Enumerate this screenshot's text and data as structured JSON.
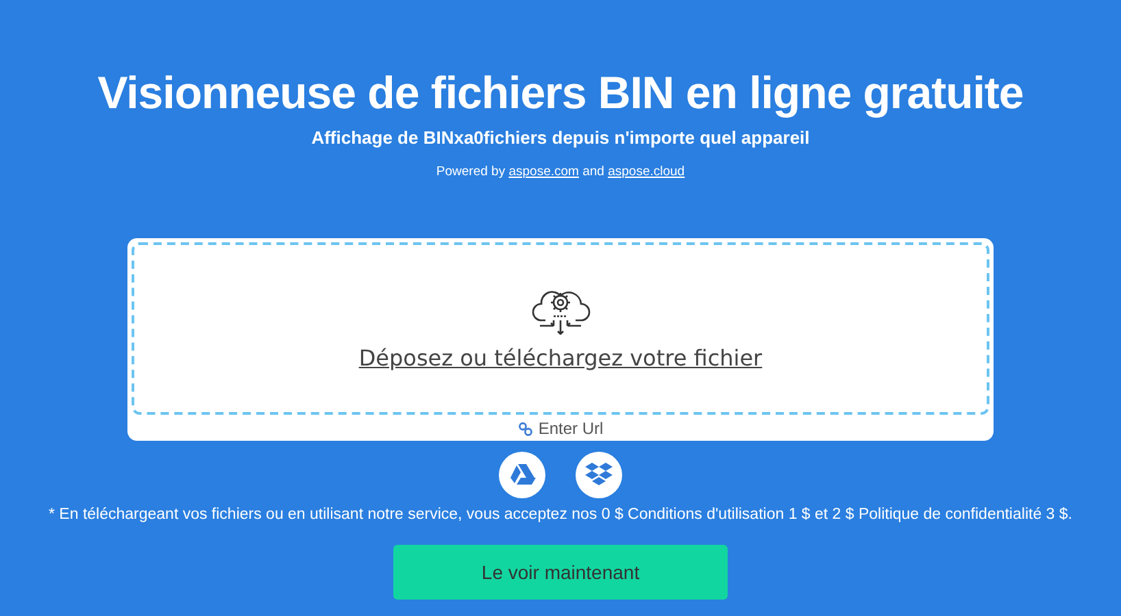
{
  "title": "Visionneuse de fichiers BIN en ligne gratuite",
  "subtitle": "Affichage de BINxa0fichiers depuis n'importe quel appareil",
  "powered": {
    "prefix": "Powered by",
    "links": [
      "aspose.com",
      "aspose.cloud"
    ],
    "joiner": "and"
  },
  "upload": {
    "label": "Déposez ou téléchargez votre fichier",
    "url_label": "Enter Url"
  },
  "cloud_sources": [
    {
      "kind": "drive"
    },
    {
      "kind": "dropbox"
    }
  ],
  "terms": "* En téléchargeant vos fichiers ou en utilisant notre service, vous acceptez nos 0 $ Conditions d'utilisation 1 $ et 2 $ Politique de confidentialité 3 $.",
  "action_button": "Le voir maintenant"
}
